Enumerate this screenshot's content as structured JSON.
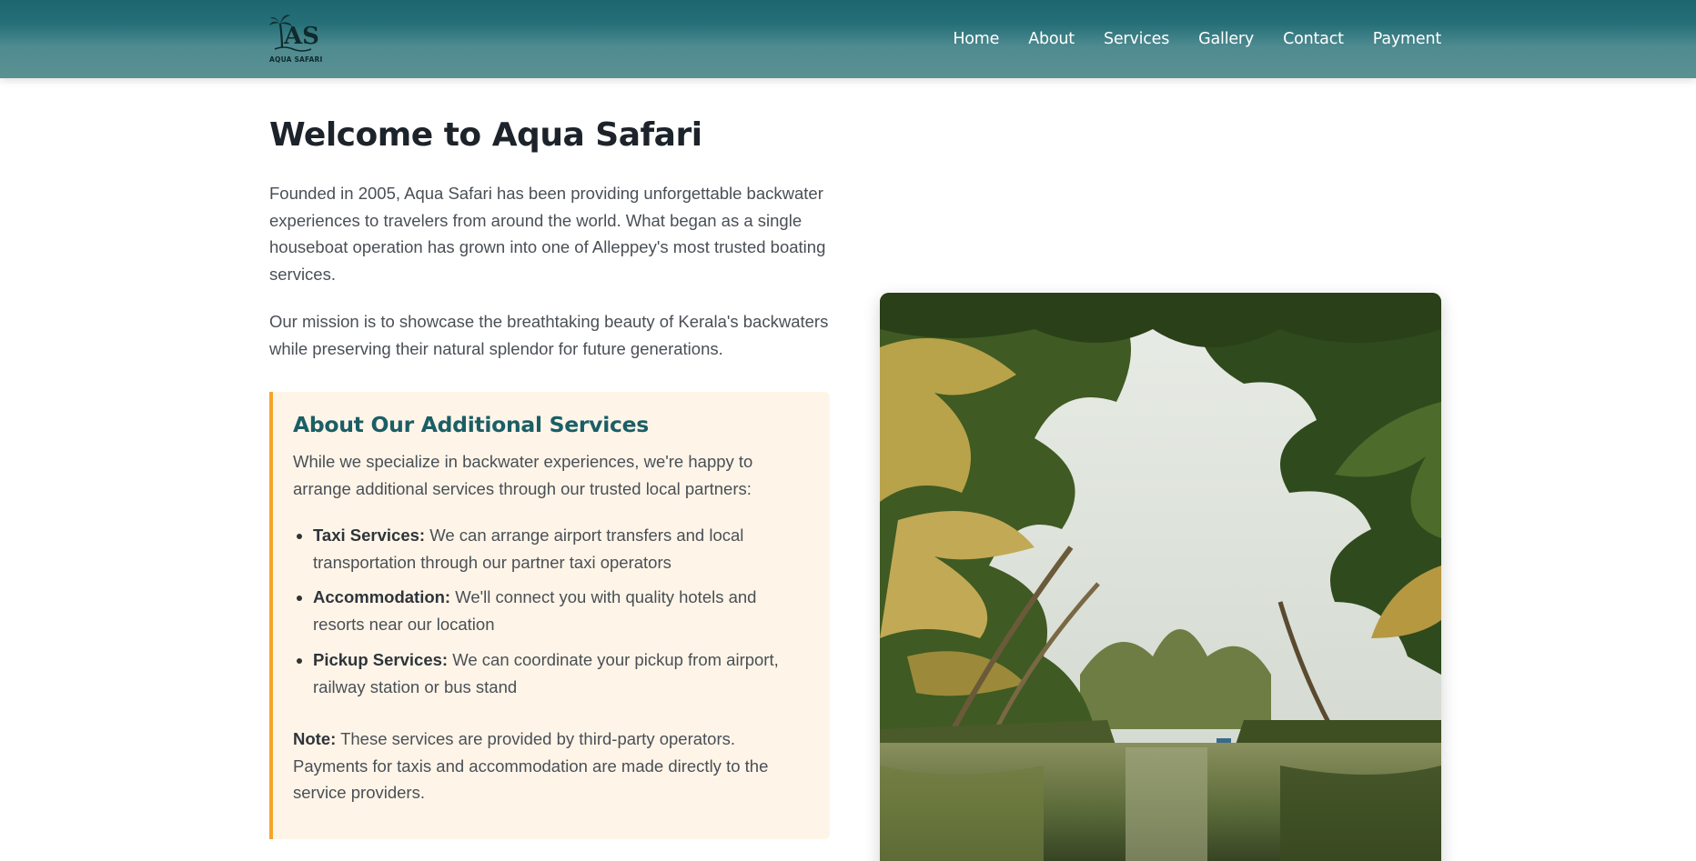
{
  "brand": {
    "logo_text": "AQUA SAFARI",
    "logo_mark": "AS"
  },
  "nav": {
    "items": [
      "Home",
      "About",
      "Services",
      "Gallery",
      "Contact",
      "Payment"
    ]
  },
  "about": {
    "title": "Welcome to Aqua Safari",
    "paragraph1": "Founded in 2005, Aqua Safari has been providing unforgettable backwater experiences to travelers from around the world. What began as a single houseboat operation has grown into one of Alleppey's most trusted boating services.",
    "paragraph2": "Our mission is to showcase the breathtaking beauty of Kerala's backwaters while preserving their natural splendor for future generations."
  },
  "services_box": {
    "title": "About Our Additional Services",
    "intro": "While we specialize in backwater experiences, we're happy to arrange additional services through our trusted local partners:",
    "items": [
      {
        "label": "Taxi Services:",
        "text": " We can arrange airport transfers and local transportation through our partner taxi operators"
      },
      {
        "label": "Accommodation:",
        "text": " We'll connect you with quality hotels and resorts near our location"
      },
      {
        "label": "Pickup Services:",
        "text": " We can coordinate your pickup from airport, railway station or bus stand"
      }
    ],
    "note_label": "Note:",
    "note_text": " These services are provided by third-party operators. Payments for taxis and accommodation are made directly to the service providers."
  },
  "colors": {
    "header": "#2a7079",
    "accent": "#f3a52c",
    "box_bg": "#fef5e8",
    "heading_teal": "#1b5e66"
  },
  "icons": {
    "logo": "palm-tree-logo-icon"
  }
}
